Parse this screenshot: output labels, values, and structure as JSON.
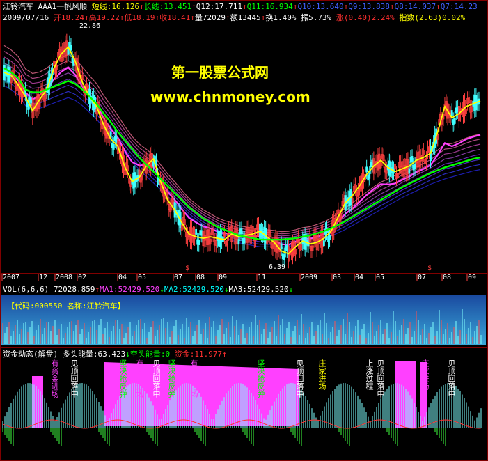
{
  "header": {
    "line1": [
      {
        "text": "江铃汽车 ",
        "color": "#ffffff"
      },
      {
        "text": "AAA1一帆风顺 ",
        "color": "#ffffff"
      },
      {
        "text": "短线:16.126",
        "color": "#ffff00"
      },
      {
        "text": "↑",
        "color": "#ff3030"
      },
      {
        "text": "长线:13.451",
        "color": "#00ff00"
      },
      {
        "text": "↑",
        "color": "#ff3030"
      },
      {
        "text": "Q12:17.711",
        "color": "#ffffff"
      },
      {
        "text": "↑",
        "color": "#ff3030"
      },
      {
        "text": "Q11:16.934",
        "color": "#00ff00"
      },
      {
        "text": "↑",
        "color": "#ff3030"
      },
      {
        "text": "Q10:13.640",
        "color": "#4060ff"
      },
      {
        "text": "↑",
        "color": "#ff3030"
      },
      {
        "text": "Q9:13.838",
        "color": "#4060ff"
      },
      {
        "text": "↑",
        "color": "#ff3030"
      },
      {
        "text": "Q8:14.037",
        "color": "#4060ff"
      },
      {
        "text": "↑",
        "color": "#ff3030"
      },
      {
        "text": "Q7:14.23",
        "color": "#4060ff"
      }
    ],
    "line2": [
      {
        "text": "2009/07/16 ",
        "color": "#ffffff"
      },
      {
        "text": "开18.24",
        "color": "#ff3030"
      },
      {
        "text": "↑",
        "color": "#ff3030"
      },
      {
        "text": "高19.22",
        "color": "#ff3030"
      },
      {
        "text": "↑",
        "color": "#ff3030"
      },
      {
        "text": "低18.19",
        "color": "#ff3030"
      },
      {
        "text": "↑",
        "color": "#ff3030"
      },
      {
        "text": "收18.41",
        "color": "#ff3030"
      },
      {
        "text": "↑",
        "color": "#ff3030"
      },
      {
        "text": "量72029",
        "color": "#ffffff"
      },
      {
        "text": "↑",
        "color": "#ff3030"
      },
      {
        "text": "额13445",
        "color": "#ffffff"
      },
      {
        "text": "↑",
        "color": "#ff3030"
      },
      {
        "text": "换1.40%",
        "color": "#ffffff"
      },
      {
        "text": " 振5.73%",
        "color": "#ffffff"
      },
      {
        "text": " 涨(0.40)2.24%",
        "color": "#ff3030"
      },
      {
        "text": " 指数(2.63)0.02%",
        "color": "#ffff00"
      }
    ]
  },
  "watermark": {
    "line1": "第一股票公式网",
    "line2": "www.chnmoney.com"
  },
  "price_marks": {
    "high": "22.86",
    "low": "6.39"
  },
  "time_axis": {
    "labels": [
      "2007",
      "12",
      "2008",
      "02",
      "04",
      "05",
      "07",
      "08",
      "09",
      "11",
      "2009",
      "03",
      "04",
      "05",
      "07",
      "08",
      "09"
    ],
    "signal_mark": "$"
  },
  "vol_header": [
    {
      "text": "VOL(6,6,6) ",
      "color": "#ffffff"
    },
    {
      "text": "72028.859",
      "color": "#ffffff"
    },
    {
      "text": "↑",
      "color": "#ff3030"
    },
    {
      "text": "MA1:52429.520",
      "color": "#ff40ff"
    },
    {
      "text": "↓",
      "color": "#00ff00"
    },
    {
      "text": "MA2:52429.520",
      "color": "#00ffff"
    },
    {
      "text": "↓",
      "color": "#00ff00"
    },
    {
      "text": "MA3:52429.520",
      "color": "#ffffff"
    },
    {
      "text": "↓",
      "color": "#00ff00"
    }
  ],
  "stock_info": "【代码:000550 名称:江铃汽车】",
  "fund_header": [
    {
      "text": "资金动态(解盘) ",
      "color": "#ffffff"
    },
    {
      "text": "多头能量:63.423",
      "color": "#ffffff"
    },
    {
      "text": "↓",
      "color": "#00ff00"
    },
    {
      "text": "空头能量:0",
      "color": "#00ff00"
    },
    {
      "text": " 资金:11.977",
      "color": "#ff3030"
    },
    {
      "text": "↑",
      "color": "#ff3030"
    }
  ],
  "signals": [
    {
      "text": "有资金进场",
      "color": "#ff40ff"
    },
    {
      "text": "见顶回落中",
      "color": "#ffffff"
    },
    {
      "text": "坚决抢反弹",
      "color": "#00ff00"
    },
    {
      "text": "有资金进场",
      "color": "#ff40ff"
    },
    {
      "text": "见顶回落中",
      "color": "#ffffff"
    },
    {
      "text": "坚决抢反弹",
      "color": "#00ff00"
    },
    {
      "text": "有资金进场",
      "color": "#ff40ff"
    },
    {
      "text": "坚决抢反弹",
      "color": "#00ff00"
    },
    {
      "text": "见顶回落中",
      "color": "#ffffff"
    },
    {
      "text": "庄家进场",
      "color": "#ffff00"
    },
    {
      "text": "上涨过程",
      "color": "#ffffff"
    },
    {
      "text": "见顶回落中",
      "color": "#ffffff"
    },
    {
      "text": "庄家进场",
      "color": "#ff40ff"
    },
    {
      "text": "见顶回落中",
      "color": "#ffffff"
    }
  ],
  "chart_data": {
    "type": "line",
    "price_range": [
      6.39,
      22.86
    ],
    "series": [
      {
        "name": "短线",
        "color": "#ffff00",
        "values": [
          20.2,
          20.0,
          19.3,
          18.5,
          17.5,
          18.3,
          19.0,
          20.5,
          21.5,
          22.0,
          21.0,
          19.5,
          18.5,
          17.8,
          16.5,
          15.5,
          15.0,
          13.5,
          12.5,
          12.8,
          13.6,
          14.1,
          12.5,
          11.2,
          10.5,
          9.6,
          8.8,
          8.6,
          8.5,
          8.6,
          8.5,
          8.4,
          8.8,
          8.6,
          8.7,
          8.8,
          9.0,
          8.6,
          8.2,
          7.6,
          7.4,
          7.9,
          8.3,
          8.1,
          8.2,
          8.5,
          9.0,
          10.0,
          11.0,
          11.5,
          12.2,
          13.0,
          13.6,
          14.0,
          13.5,
          13.2,
          13.4,
          13.6,
          14.0,
          14.2,
          14.5,
          16.0,
          17.8,
          17.0,
          17.3,
          17.8,
          18.0,
          18.2
        ]
      },
      {
        "name": "长线",
        "color": "#00ff00",
        "values": [
          20.5,
          20.2,
          19.8,
          19.0,
          18.8,
          18.8,
          19.0,
          19.2,
          19.4,
          19.6,
          19.4,
          19.0,
          18.5,
          18.0,
          17.3,
          16.7,
          16.0,
          15.4,
          14.8,
          14.2,
          13.7,
          13.2,
          12.7,
          12.2,
          11.7,
          11.2,
          10.7,
          10.3,
          9.9,
          9.6,
          9.3,
          9.1,
          8.9,
          8.7,
          8.6,
          8.5,
          8.4,
          8.4,
          8.4,
          8.4,
          8.45,
          8.5,
          8.6,
          8.7,
          8.85,
          9.0,
          9.2,
          9.45,
          9.7,
          10.0,
          10.3,
          10.6,
          10.9,
          11.2,
          11.5,
          11.8,
          12.1,
          12.35,
          12.6,
          12.85,
          13.1,
          13.3,
          13.5,
          13.65,
          13.8,
          13.95,
          14.1,
          14.2
        ]
      }
    ]
  }
}
